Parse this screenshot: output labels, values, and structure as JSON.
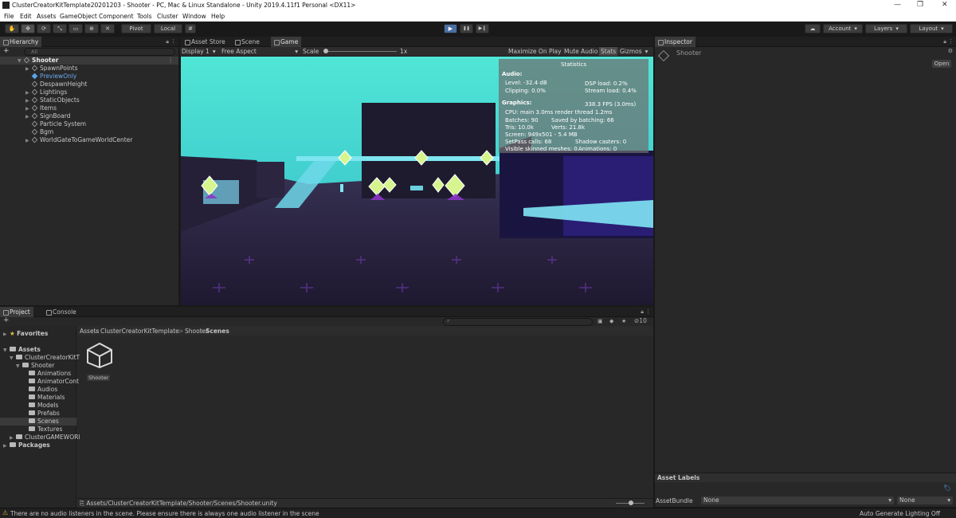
{
  "window": {
    "title": "ClusterCreatorKitTemplate20201203 - Shooter - PC, Mac & Linux Standalone - Unity 2019.4.11f1 Personal <DX11>",
    "minimize": "—",
    "maximize": "❐",
    "close": "✕"
  },
  "menu": [
    "File",
    "Edit",
    "Assets",
    "GameObject",
    "Component",
    "Tools",
    "Cluster",
    "Window",
    "Help"
  ],
  "toolbar": {
    "pivot": "Pivot",
    "local": "Local",
    "account": "Account",
    "layers": "Layers",
    "layout": "Layout",
    "play_icon": "▶",
    "pause_icon": "❚❚",
    "step_icon": "▶❙",
    "cloud_icon": "☁"
  },
  "hierarchy": {
    "tab": "Hierarchy",
    "search_placeholder": "All",
    "add": "+",
    "root": "Shooter",
    "items": [
      "SpawnPoints",
      "PreviewOnly",
      "DespawnHeight",
      "Lightings",
      "StaticObjects",
      "Items",
      "SignBoard",
      "Particle System",
      "Bgm",
      "WorldGateToGameWorldCenter"
    ]
  },
  "tabs": {
    "asset_store": "Asset Store",
    "scene": "Scene",
    "game": "Game"
  },
  "game": {
    "display": "Display 1",
    "aspect": "Free Aspect",
    "scale_label": "Scale",
    "scale_value": "1x",
    "maximize": "Maximize On Play",
    "mute": "Mute Audio",
    "stats": "Stats",
    "gizmos": "Gizmos"
  },
  "stats": {
    "title": "Statistics",
    "audio_head": "Audio:",
    "level": "Level: -32.4 dB",
    "clipping": "Clipping: 0.0%",
    "dsp": "DSP load: 0.2%",
    "stream": "Stream load: 0.4%",
    "graphics_head": "Graphics:",
    "fps": "338.3 FPS (3.0ms)",
    "cpu": "CPU: main 3.0ms  render thread 1.2ms",
    "batches": "Batches: 90",
    "saved": "Saved by batching: 66",
    "tris": "Tris: 10.0k",
    "verts": "Verts: 21.8k",
    "screen": "Screen: 949x501 - 5.4 MB",
    "setpass": "SetPass calls: 68",
    "shadow": "Shadow casters: 0",
    "skinned": "Visible skinned meshes: 0",
    "animations": "Animations: 0"
  },
  "inspector": {
    "tab": "Inspector",
    "name": "Shooter",
    "open": "Open",
    "asset_labels": "Asset Labels",
    "bundle_label": "AssetBundle",
    "bundle_value": "None",
    "variant_value": "None"
  },
  "project": {
    "tab": "Project",
    "console_tab": "Console",
    "add": "+",
    "count": "10",
    "tree": [
      {
        "label": "Favorites",
        "indent": 0,
        "kind": "star"
      },
      {
        "label": "Assets",
        "indent": 0,
        "kind": "folder"
      },
      {
        "label": "ClusterCreatorKitT",
        "indent": 1,
        "kind": "folder"
      },
      {
        "label": "Shooter",
        "indent": 2,
        "kind": "folder"
      },
      {
        "label": "Animations",
        "indent": 3,
        "kind": "folder"
      },
      {
        "label": "AnimatorCont",
        "indent": 3,
        "kind": "folder"
      },
      {
        "label": "Audios",
        "indent": 3,
        "kind": "folder"
      },
      {
        "label": "Materials",
        "indent": 3,
        "kind": "folder"
      },
      {
        "label": "Models",
        "indent": 3,
        "kind": "folder"
      },
      {
        "label": "Prefabs",
        "indent": 3,
        "kind": "folder"
      },
      {
        "label": "Scenes",
        "indent": 3,
        "kind": "folder"
      },
      {
        "label": "Textures",
        "indent": 3,
        "kind": "folder"
      },
      {
        "label": "ClusterGAMEWORl",
        "indent": 1,
        "kind": "folder"
      },
      {
        "label": "Packages",
        "indent": 0,
        "kind": "folder"
      }
    ],
    "breadcrumb": [
      "Assets",
      "ClusterCreatorKitTemplate",
      "Shooter",
      "Scenes"
    ],
    "asset": "Shooter",
    "path": "Assets/ClusterCreatorKitTemplate/Shooter/Scenes/Shooter.unity"
  },
  "status": {
    "message": "There are no audio listeners in the scene. Please ensure there is always one audio listener in the scene",
    "lighting": "Auto Generate Lighting Off"
  },
  "colors": {
    "accent": "#4a6fa5",
    "highlight_circle": "#c0181c",
    "sky": "#3fd6c9",
    "floor": "#2a2345"
  }
}
